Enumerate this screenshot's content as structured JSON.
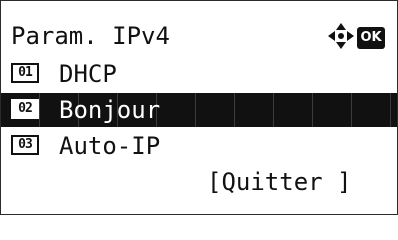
{
  "screen": {
    "title": "Param. IPv4",
    "nav_icon": "four-way-arrow-icon",
    "ok_label": "OK"
  },
  "menu": {
    "items": [
      {
        "number": "01",
        "label": "DHCP",
        "selected": false
      },
      {
        "number": "02",
        "label": "Bonjour",
        "selected": true
      },
      {
        "number": "03",
        "label": "Auto-IP",
        "selected": false
      }
    ]
  },
  "softkey": {
    "label": "[Quitter ]"
  },
  "colors": {
    "background": "#ffffff",
    "foreground": "#111111",
    "highlight": "#111111"
  }
}
